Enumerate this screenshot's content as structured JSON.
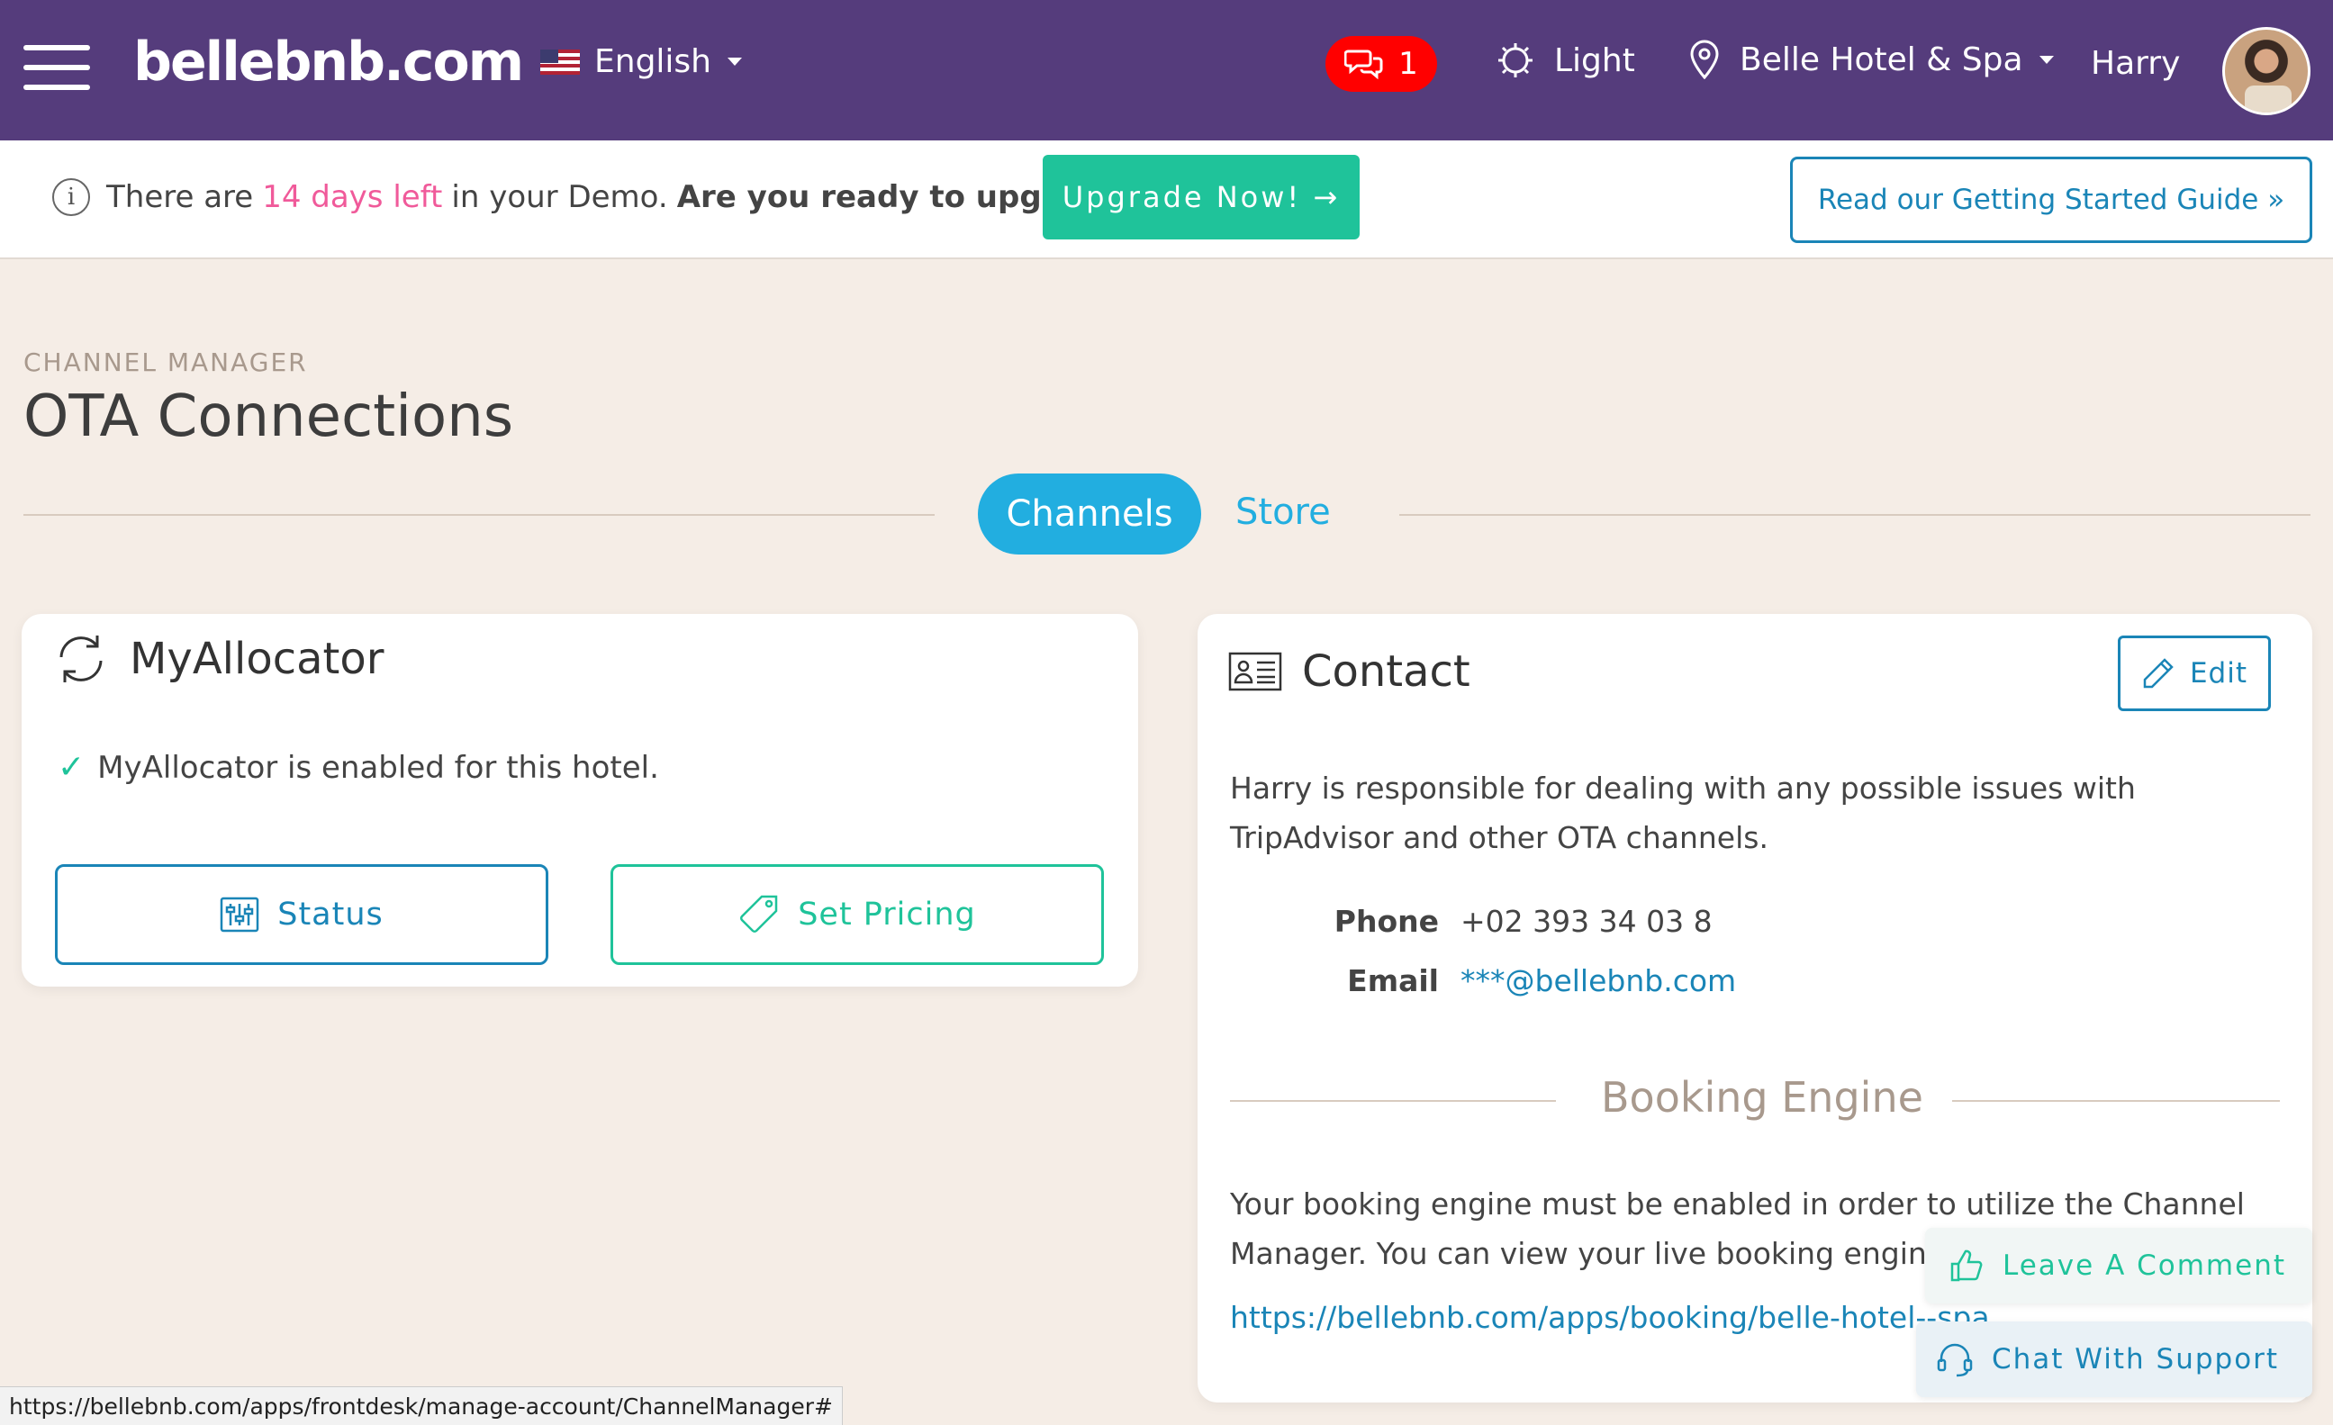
{
  "navbar": {
    "logo": "bellebnb.com",
    "language": "English",
    "messages_count": "1",
    "theme": "Light",
    "hotel": "Belle Hotel & Spa",
    "user": "Harry",
    "bg_color": "#553c7c"
  },
  "demo_bar": {
    "prefix": "There are",
    "days_left": "14 days left",
    "middle": "in your Demo.",
    "question": "Are you ready to upgrade?",
    "upgrade_label": "Upgrade Now! →",
    "guide_label": "Read our Getting Started Guide »"
  },
  "header": {
    "eyebrow": "CHANNEL MANAGER",
    "title": "OTA Connections"
  },
  "tabs": [
    {
      "label": "Channels",
      "active": true
    },
    {
      "label": "Store",
      "active": false
    }
  ],
  "myallocator": {
    "title": "MyAllocator",
    "enabled_text": "MyAllocator is enabled for this hotel.",
    "status_label": "Status",
    "pricing_label": "Set Pricing"
  },
  "contact": {
    "title": "Contact",
    "edit_label": "Edit",
    "description": "Harry is responsible for dealing with any possible issues with TripAdvisor and other OTA channels.",
    "phone_label": "Phone",
    "phone_value": "+02 393 34 03 8",
    "email_label": "Email",
    "email_value": "***@bellebnb.com",
    "booking_engine_title": "Booking Engine",
    "booking_engine_desc": "Your booking engine must be enabled in order to utilize the Channel Manager. You can view your live booking engine l",
    "booking_engine_link": "https://bellebnb.com/apps/booking/belle-hotel--spa"
  },
  "widgets": {
    "comment_label": "Leave A Comment",
    "chat_label": "Chat With Support"
  },
  "status_url": "https://bellebnb.com/apps/frontdesk/manage-account/ChannelManager#",
  "colors": {
    "accent_blue": "#22aee0",
    "link_blue": "#1a85b7",
    "green": "#1fc39a",
    "pink": "#f05a9a",
    "badge_red": "#ff0000"
  }
}
